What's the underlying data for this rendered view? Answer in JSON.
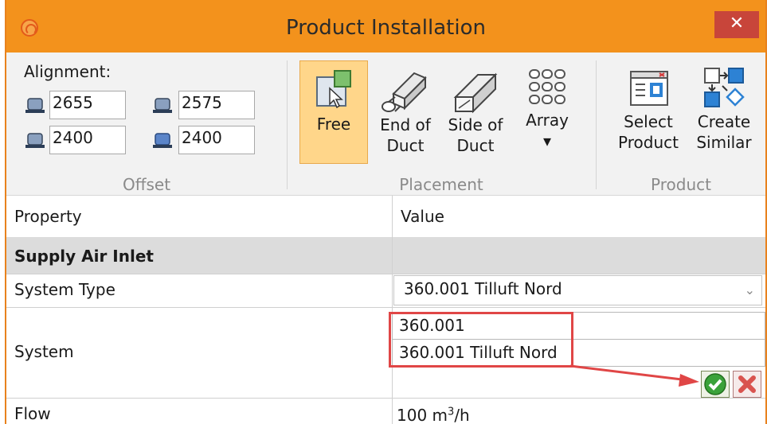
{
  "window": {
    "title": "Product Installation",
    "close_glyph": "✕",
    "accent_color": "#f3921c"
  },
  "ribbon": {
    "offset": {
      "heading": "Alignment:",
      "group_label": "Offset",
      "fields": [
        {
          "value": "2655",
          "icon": "shape-top-icon"
        },
        {
          "value": "2575",
          "icon": "shape-left-icon"
        },
        {
          "value": "2400",
          "icon": "shape-bottom-icon"
        },
        {
          "value": "2400",
          "icon": "shape-right-icon"
        }
      ]
    },
    "placement": {
      "group_label": "Placement",
      "buttons": [
        {
          "line1": "Free",
          "line2": "",
          "icon": "free-cursor-icon",
          "active": true
        },
        {
          "line1": "End of",
          "line2": "Duct",
          "icon": "end-of-duct-icon"
        },
        {
          "line1": "Side of",
          "line2": "Duct",
          "icon": "side-of-duct-icon"
        },
        {
          "line1": "Array",
          "line2": "▾",
          "icon": "array-dots-icon"
        }
      ]
    },
    "product": {
      "group_label": "Product",
      "buttons": [
        {
          "line1": "Select",
          "line2": "Product",
          "icon": "select-product-icon"
        },
        {
          "line1": "Create",
          "line2": "Similar",
          "icon": "create-similar-icon"
        }
      ]
    }
  },
  "grid": {
    "header": {
      "property": "Property",
      "value": "Value"
    },
    "category": "Supply Air Inlet",
    "rows": {
      "system_type": {
        "label": "System Type",
        "value": "360.001 Tilluft Nord"
      },
      "system": {
        "label": "System",
        "code_input": "360.001",
        "name_input": "360.001 Tilluft Nord"
      },
      "flow": {
        "label": "Flow",
        "value": "100",
        "unit": "m",
        "unit_sup": "3",
        "unit_tail": "/h"
      }
    }
  },
  "annotation": {
    "color": "#e04646"
  }
}
